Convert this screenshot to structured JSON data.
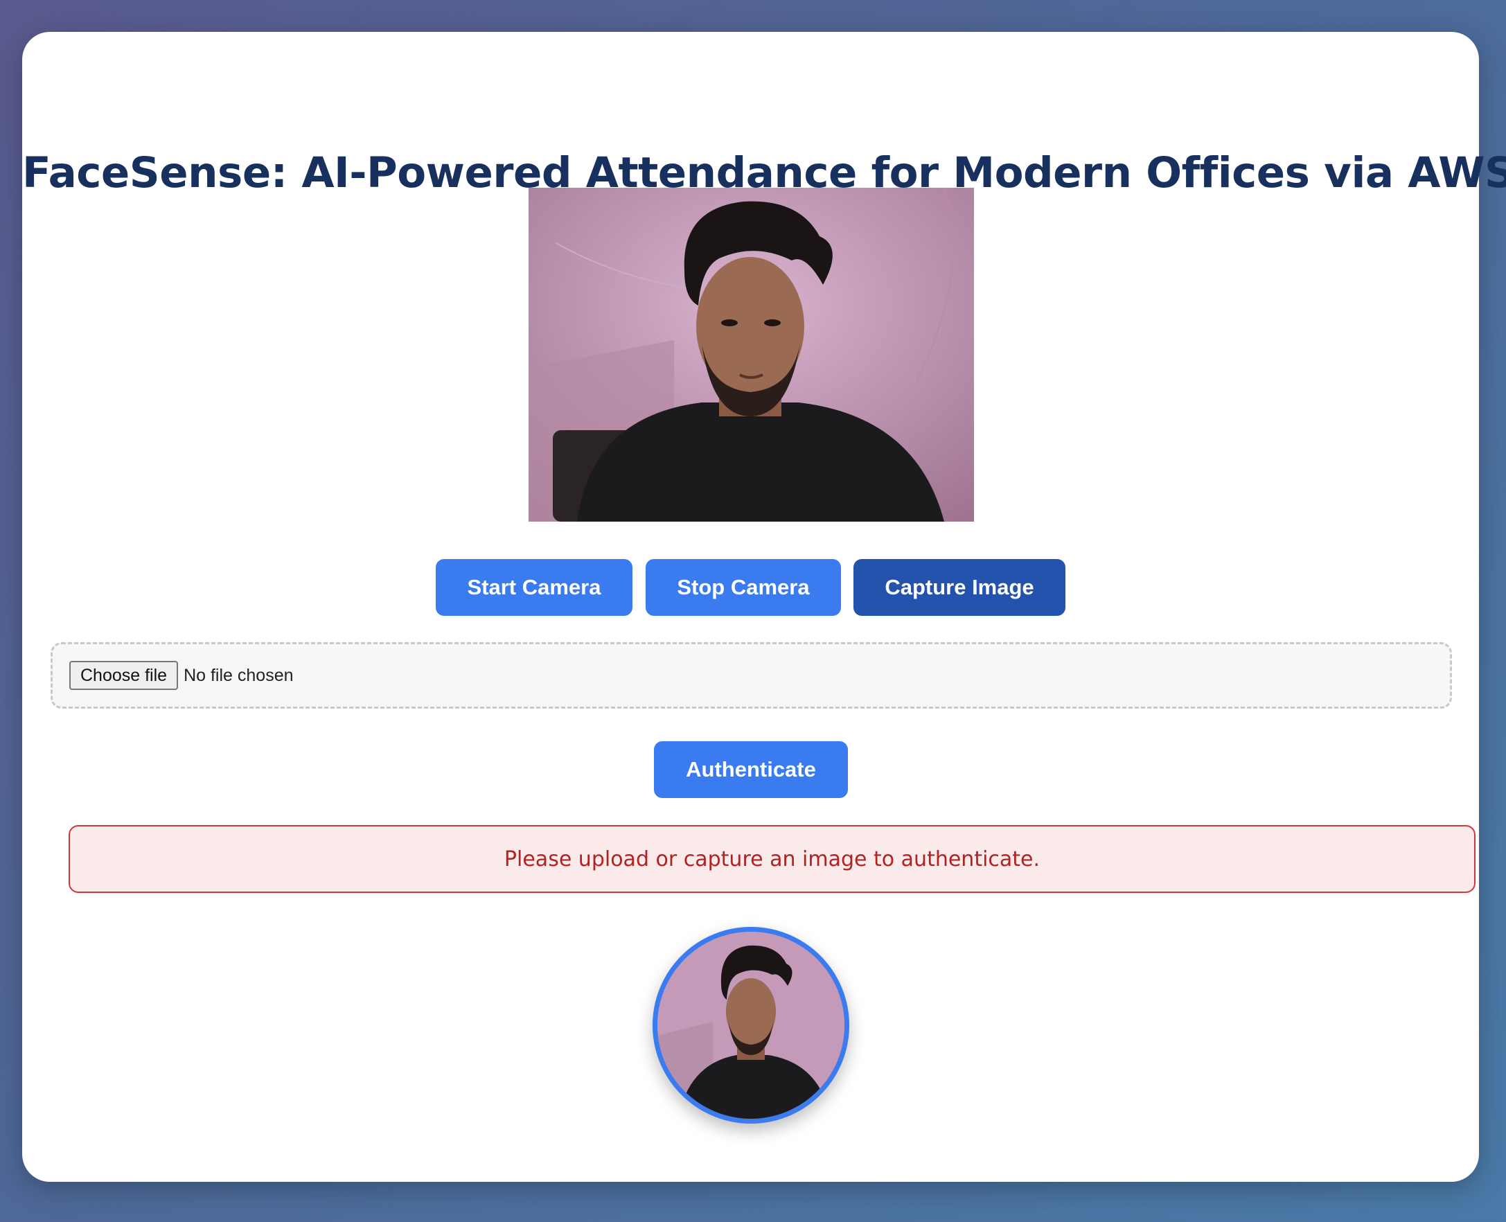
{
  "header": {
    "title": "FaceSense: AI-Powered Attendance for Modern Offices via AWS"
  },
  "camera": {
    "preview_icon": "person-photo-icon"
  },
  "controls": {
    "start_label": "Start Camera",
    "stop_label": "Stop Camera",
    "capture_label": "Capture Image"
  },
  "upload": {
    "button_label": "Choose file",
    "status": "No file chosen"
  },
  "auth": {
    "button_label": "Authenticate"
  },
  "alert": {
    "message": "Please upload or capture an image to authenticate."
  },
  "colors": {
    "primary": "#3a7bf0",
    "primary_dark": "#2353ad",
    "title": "#17305e",
    "error_text": "#b02323",
    "error_bg": "#fbeaea"
  }
}
